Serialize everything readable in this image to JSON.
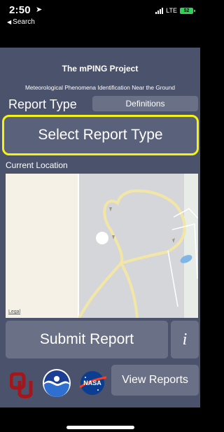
{
  "status_bar": {
    "time": "2:50",
    "back_label": "Search",
    "network": "LTE",
    "battery": "52"
  },
  "app": {
    "title": "The mPING Project",
    "subtitle": "Meteorological Phenomena Identification Near the Ground",
    "report_type_label": "Report Type",
    "definitions_label": "Definitions",
    "select_report_type_label": "Select Report Type",
    "current_location_label": "Current Location",
    "map_legal": "Legal",
    "submit_label": "Submit Report",
    "info_label": "i",
    "view_reports_label": "View Reports",
    "highlight_color": "#f3f314"
  },
  "logos": {
    "ou": "OU",
    "noaa": "NOAA",
    "nasa": "NASA"
  }
}
